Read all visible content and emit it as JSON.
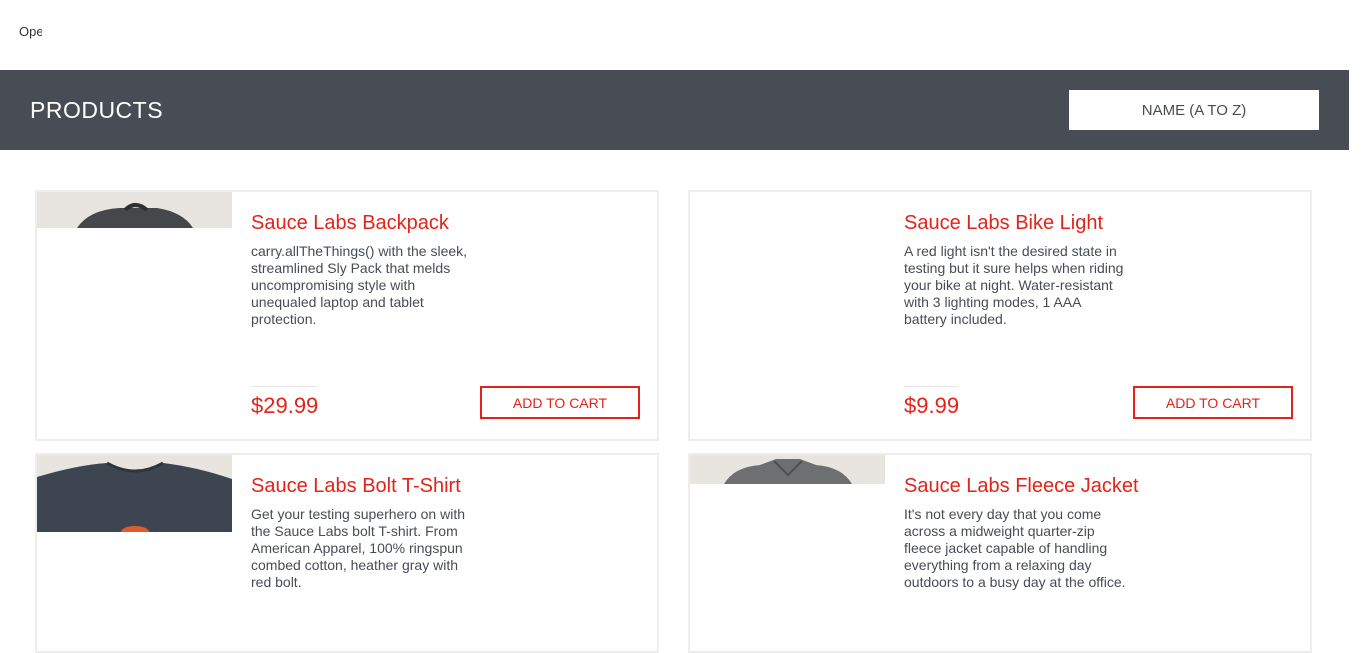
{
  "menu": {
    "label": "Open Menu"
  },
  "header": {
    "title": "PRODUCTS",
    "sort_selected": "NAME (A TO Z)"
  },
  "products": [
    {
      "name": "Sauce Labs Backpack",
      "description": "carry.allTheThings() with the sleek, streamlined Sly Pack that melds uncompromising style with unequaled laptop and tablet protection.",
      "price": "$29.99",
      "button": "ADD TO CART"
    },
    {
      "name": "Sauce Labs Bike Light",
      "description": "A red light isn't the desired state in testing but it sure helps when riding your bike at night. Water-resistant with 3 lighting modes, 1 AAA battery included.",
      "price": "$9.99",
      "button": "ADD TO CART"
    },
    {
      "name": "Sauce Labs Bolt T-Shirt",
      "description": "Get your testing superhero on with the Sauce Labs bolt T-shirt. From American Apparel, 100% ringspun combed cotton, heather gray with red bolt."
    },
    {
      "name": "Sauce Labs Fleece Jacket",
      "description": "It's not every day that you come across a midweight quarter-zip fleece jacket capable of handling everything from a relaxing day outdoors to a busy day at the office."
    }
  ],
  "colors": {
    "accent": "#e2231a",
    "header_bg": "#474c55",
    "text": "#484c55"
  }
}
